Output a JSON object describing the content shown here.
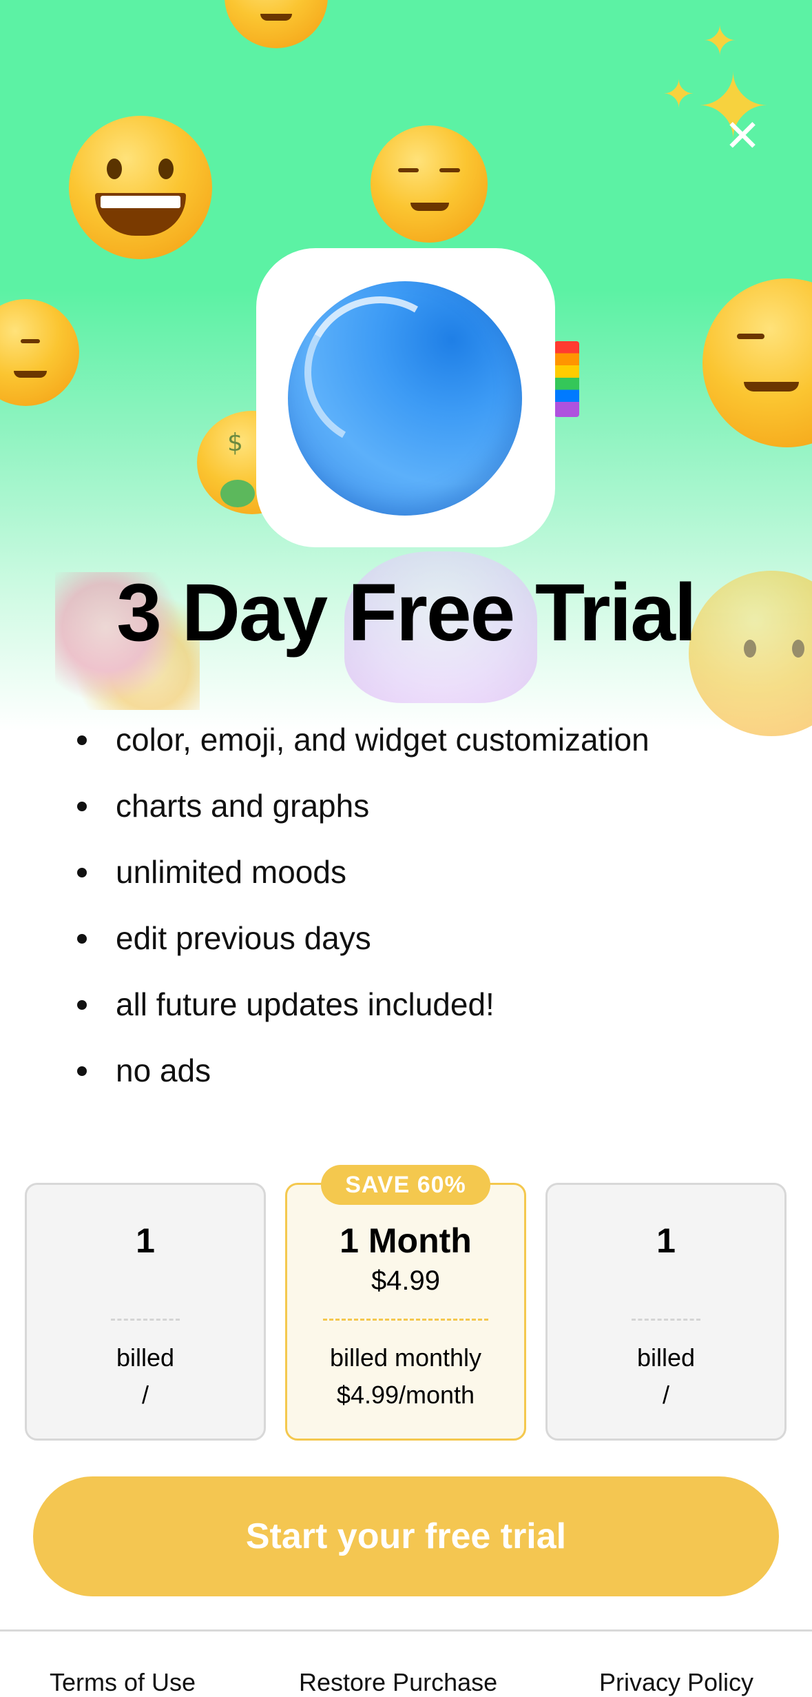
{
  "hero": {
    "title": "3 Day Free Trial",
    "app_icon": "blue-orb-app-icon",
    "decorations": [
      "grinning-emoji",
      "smiling-emoji",
      "blushing-emoji",
      "money-mouth-emoji",
      "wink-emoji",
      "crying-emoji",
      "sparkles-icon",
      "rainbow-flag",
      "unicorn-emoji",
      "bouquet-emoji"
    ]
  },
  "close": {
    "icon": "close-icon",
    "glyph": "✕"
  },
  "features": [
    "color, emoji, and widget customization",
    "charts and graphs",
    "unlimited moods",
    "edit previous days",
    "all future updates included!",
    "no ads"
  ],
  "plans": [
    {
      "duration": "1",
      "price": "",
      "billed": "billed",
      "per": "/",
      "selected": false
    },
    {
      "duration": "1 Month",
      "price": "$4.99",
      "billed": "billed monthly",
      "per": "$4.99/month",
      "selected": true,
      "badge": "SAVE 60%"
    },
    {
      "duration": "1",
      "price": "",
      "billed": "billed",
      "per": "/",
      "selected": false
    }
  ],
  "cta": {
    "label": "Start your free trial"
  },
  "footer": {
    "terms": "Terms of Use",
    "restore": "Restore Purchase",
    "privacy": "Privacy Policy"
  },
  "colors": {
    "hero_green": "#5cf2a4",
    "accent_yellow": "#f4c651",
    "selected_bg": "#fcf8ea",
    "app_blue": "#3d9bf5"
  }
}
